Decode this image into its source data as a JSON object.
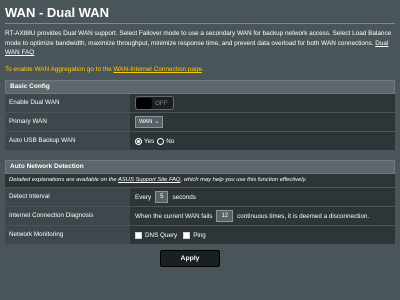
{
  "page": {
    "title": "WAN - Dual WAN",
    "description": "RT-AX88U provides Dual WAN support. Select Failover mode to use a secondary WAN for backup network access. Select Load Balance mode to optimize bandwidth, maximize throughput, minimize response time, and prevent data overload for both WAN connections.",
    "faq_link": "Dual WAN FAQ",
    "aggregation_prefix": "To enable WAN Aggregation go to the ",
    "aggregation_link": "WAN-Internet Connection page",
    "aggregation_suffix": "."
  },
  "basic_config": {
    "header": "Basic Config",
    "enable_dual_wan": {
      "label": "Enable Dual WAN",
      "state": "OFF"
    },
    "primary_wan": {
      "label": "Primary WAN",
      "value": "WAN",
      "arrow": "⌄"
    },
    "auto_usb_backup": {
      "label": "Auto USB Backup WAN",
      "yes": "Yes",
      "no": "No",
      "selected": "Yes"
    }
  },
  "auto_detection": {
    "header": "Auto Network Detection",
    "notice_prefix": "Detailed explanations are available on the ",
    "notice_link": "ASUS Support Site FAQ",
    "notice_suffix": ", which may help you use this function effectively.",
    "detect_interval": {
      "label": "Detect Interval",
      "prefix": "Every",
      "value": "5",
      "suffix": "seconds"
    },
    "diagnosis": {
      "label": "Internet Connection Diagnosis",
      "prefix": "When the current WAN fails",
      "value": "12",
      "suffix": "continuous times, it is deemed a disconnection."
    },
    "monitoring": {
      "label": "Network Monitoring",
      "dns_query": "DNS Query",
      "ping": "Ping"
    }
  },
  "apply_label": "Apply",
  "colors": {
    "background": "#4a5559",
    "accent": "#ffcc00",
    "panel": "#2d3538"
  }
}
